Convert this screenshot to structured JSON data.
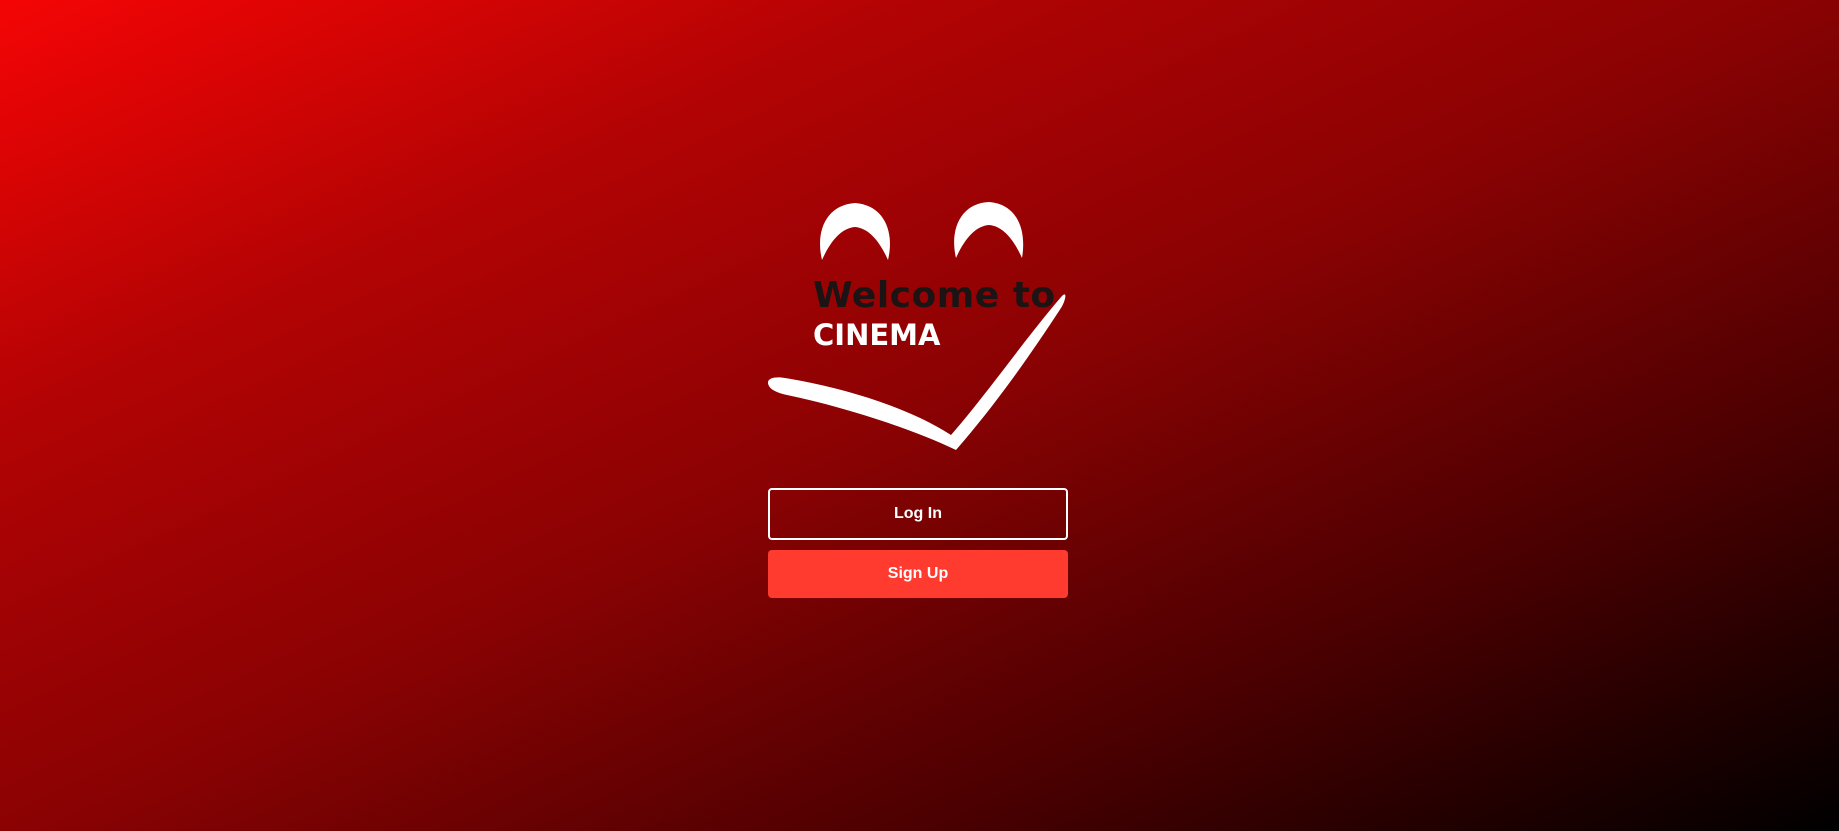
{
  "hero": {
    "title_line1": "Welcome to",
    "title_line2": "CINEMA",
    "logo_icon": "smiling-face-logo-icon"
  },
  "actions": {
    "login_label": "Log In",
    "signup_label": "Sign Up"
  },
  "colors": {
    "background_start": "#f50505",
    "background_end": "#000000",
    "signup_button": "#ff3b30",
    "title_dark": "#1c1414",
    "title_light": "#ffffff"
  }
}
